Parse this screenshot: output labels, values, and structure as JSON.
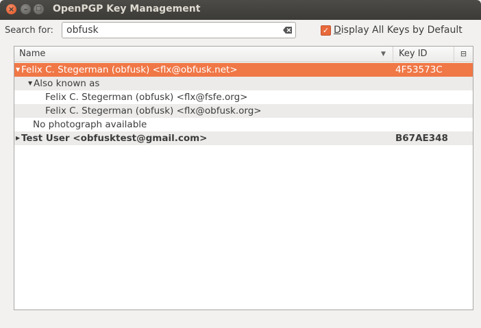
{
  "window": {
    "title": "OpenPGP Key Management"
  },
  "search": {
    "label": "Search for:",
    "value": "obfusk"
  },
  "display_all": {
    "label_prefix": "D",
    "label_rest": "isplay All Keys by Default",
    "checked": true
  },
  "columns": {
    "name": "Name",
    "key_id": "Key ID"
  },
  "rows": [
    {
      "name": "Felix C. Stegerman (obfusk) <flx@obfusk.net>",
      "key_id": "4F53573C"
    },
    {
      "name": "Also known as",
      "key_id": ""
    },
    {
      "name": "Felix C. Stegerman (obfusk) <flx@fsfe.org>",
      "key_id": ""
    },
    {
      "name": "Felix C. Stegerman (obfusk) <flx@obfusk.org>",
      "key_id": ""
    },
    {
      "name": "No photograph available",
      "key_id": ""
    },
    {
      "name": "Test User <obfusktest@gmail.com>",
      "key_id": "B67AE348"
    }
  ],
  "colors": {
    "accent": "#f07746",
    "titlebar": "#3c3b37"
  }
}
